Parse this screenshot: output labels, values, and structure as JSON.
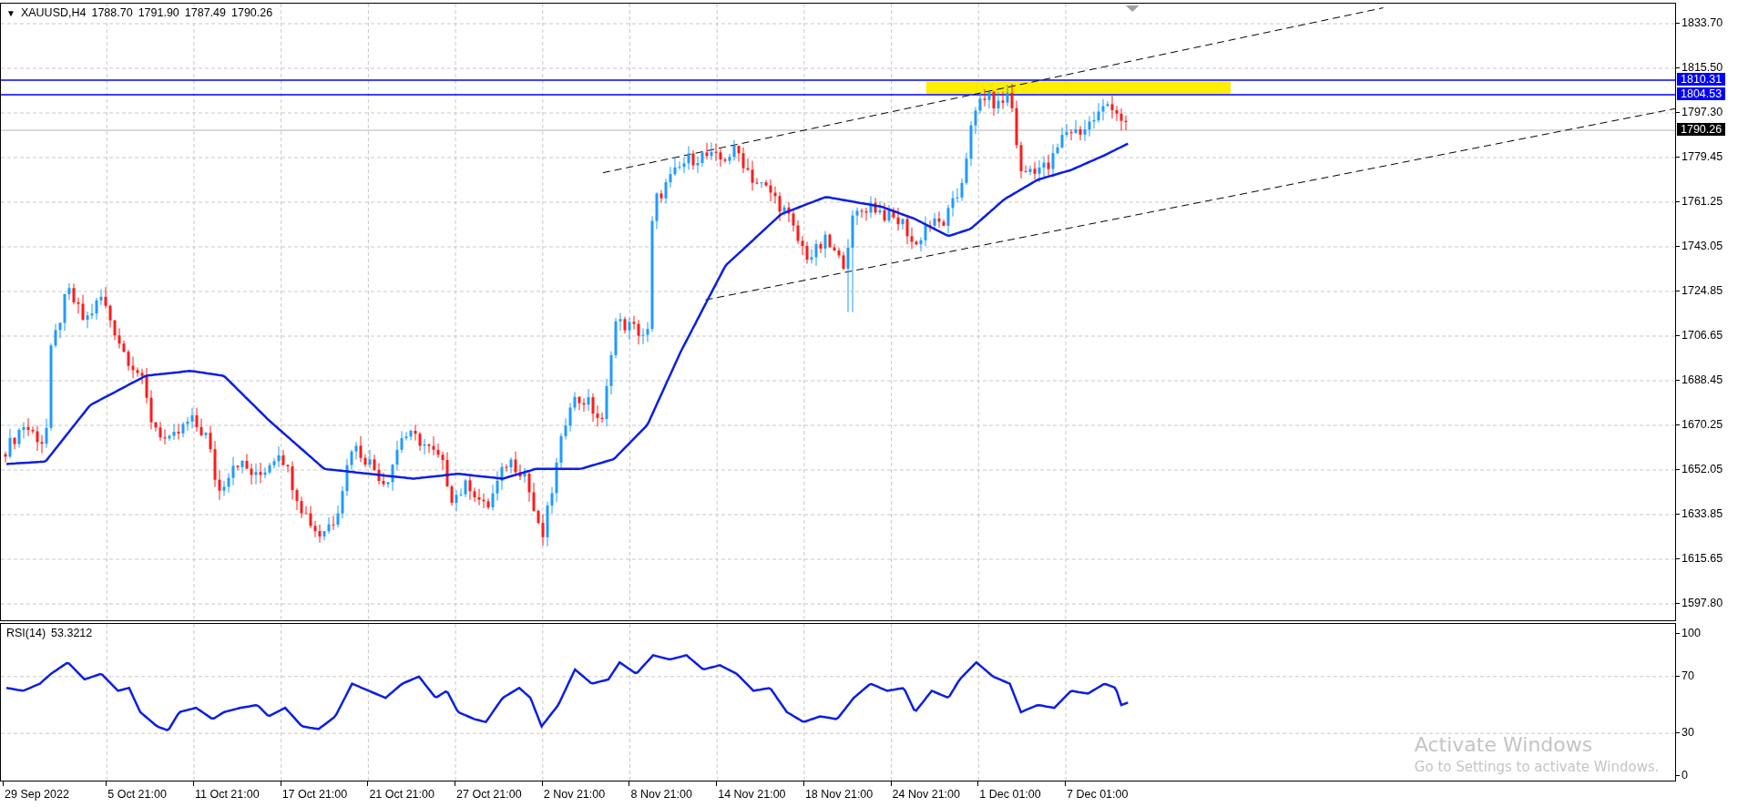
{
  "chart": {
    "menu_arrow": "▼",
    "symbol": "XAUUSD,H4",
    "ohlc": [
      "1788.70",
      "1791.90",
      "1787.49",
      "1790.26"
    ],
    "price_axis": [
      "1833.70",
      "1815.50",
      "1797.30",
      "1779.45",
      "1761.25",
      "1743.05",
      "1724.85",
      "1706.65",
      "1688.45",
      "1670.25",
      "1652.05",
      "1633.85",
      "1615.65",
      "1597.80"
    ],
    "price_tags": [
      {
        "text": "1810.31",
        "kind": "line"
      },
      {
        "text": "1804.53",
        "kind": "line"
      },
      {
        "text": "1790.26",
        "kind": "bid"
      }
    ]
  },
  "rsi": {
    "label": "RSI(14)",
    "value": "53.3212",
    "axis": [
      "100",
      "70",
      "30",
      "0"
    ]
  },
  "time_axis": [
    "29 Sep 2022",
    "5 Oct 21:00",
    "11 Oct 21:00",
    "17 Oct 21:00",
    "21 Oct 21:00",
    "27 Oct 21:00",
    "2 Nov 21:00",
    "8 Nov 21:00",
    "14 Nov 21:00",
    "18 Nov 21:00",
    "24 Nov 21:00",
    "1 Dec 01:00",
    "7 Dec 01:00"
  ],
  "os_watermark": {
    "title": "Activate Windows",
    "subtitle": "Go to Settings to activate Windows."
  }
}
